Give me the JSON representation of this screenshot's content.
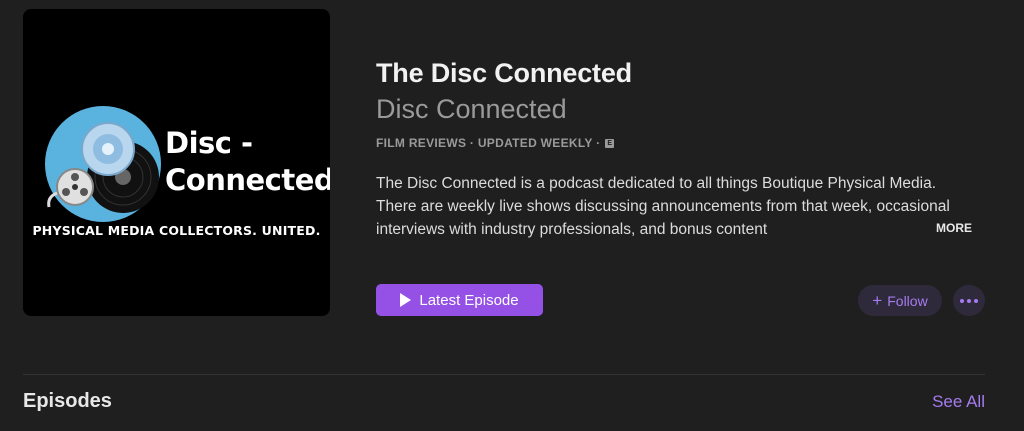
{
  "artwork": {
    "title_line1": "Disc -",
    "title_line2": "Connected",
    "tagline": "PHYSICAL MEDIA COLLECTORS. UNITED.",
    "icon": "disc-film-reel-logo",
    "bg_color": "#000000",
    "circle_color": "#5ab2de"
  },
  "podcast": {
    "title": "The Disc Connected",
    "author": "Disc Connected",
    "meta": "FILM REVIEWS · UPDATED WEEKLY ·",
    "explicit_badge": "E",
    "description": "The Disc Connected is a podcast dedicated to all things Boutique Physical Media. There are weekly live shows discussing announcements from that week, occasional interviews with industry professionals, and bonus content",
    "more_label": "MORE"
  },
  "actions": {
    "latest_episode_label": "Latest Episode",
    "follow_label": "Follow",
    "accent_color": "#9551e6"
  },
  "episodes": {
    "heading": "Episodes",
    "see_all_label": "See All"
  }
}
